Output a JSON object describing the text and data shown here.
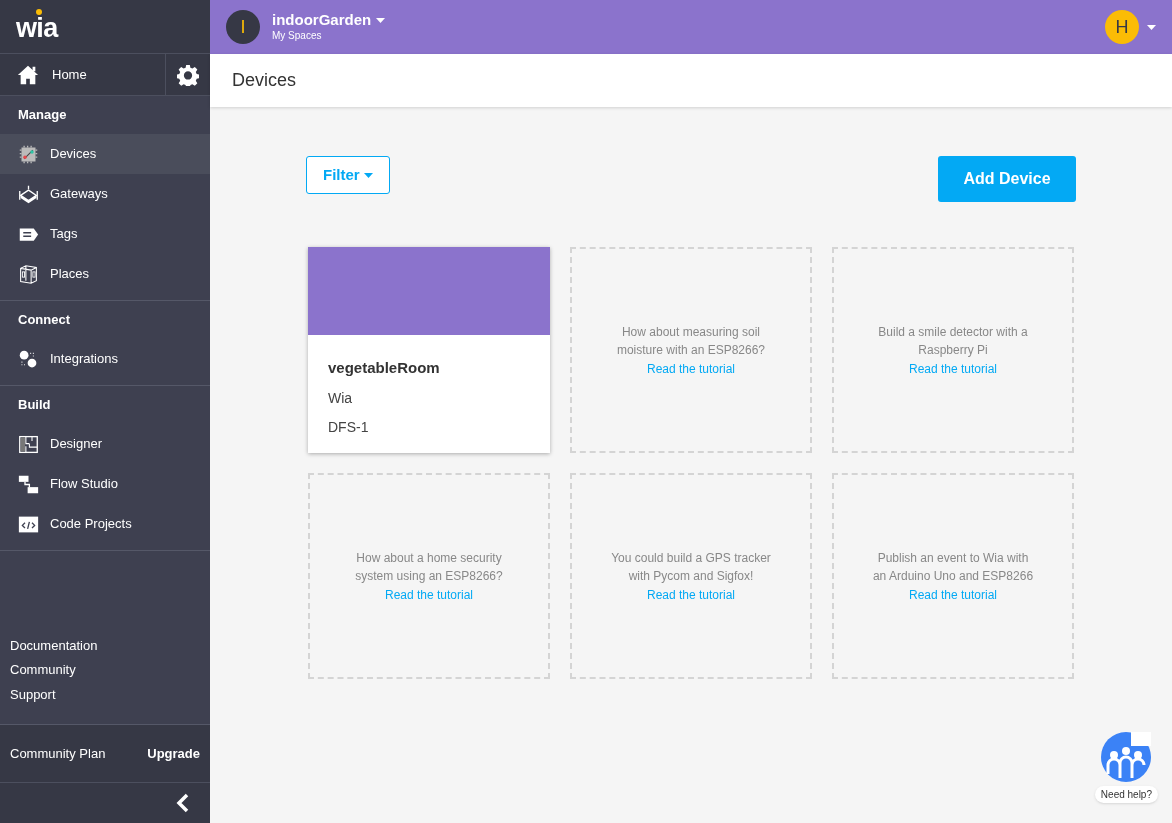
{
  "sidebar": {
    "logo": "wia",
    "home": {
      "label": "Home"
    },
    "sections": [
      {
        "heading": "Manage",
        "items": [
          {
            "label": "Devices",
            "kind": "chip",
            "selected": true
          },
          {
            "label": "Gateways",
            "kind": "gateway",
            "selected": false
          },
          {
            "label": "Tags",
            "kind": "tag",
            "selected": false
          },
          {
            "label": "Places",
            "kind": "place",
            "selected": false
          }
        ]
      },
      {
        "heading": "Connect",
        "items": [
          {
            "label": "Integrations",
            "kind": "integration",
            "selected": false
          }
        ]
      },
      {
        "heading": "Build",
        "items": [
          {
            "label": "Designer",
            "kind": "designer",
            "selected": false
          },
          {
            "label": "Flow Studio",
            "kind": "flow",
            "selected": false
          },
          {
            "label": "Code Projects",
            "kind": "code",
            "selected": false
          }
        ]
      }
    ],
    "links": [
      "Documentation",
      "Community",
      "Support"
    ],
    "plan": {
      "label": "Community Plan",
      "action": "Upgrade"
    }
  },
  "topbar": {
    "space_initial": "I",
    "space": "indoorGarden",
    "subtitle": "My Spaces",
    "user_initial": "H"
  },
  "page_title": "Devices",
  "filter": "Filter",
  "add_button": "Add Device",
  "cards": [
    {
      "kind": "device",
      "name": "vegetableRoom",
      "line_1": "Wia",
      "line_2": "DFS-1"
    },
    {
      "kind": "suggestion",
      "text": "How about measuring soil moisture with an ESP8266?",
      "link": "Read the tutorial"
    },
    {
      "kind": "suggestion",
      "text": "Build a smile detector with a Raspberry Pi",
      "link": "Read the tutorial"
    },
    {
      "kind": "suggestion",
      "text": "How about a home security system using an ESP8266?",
      "link": "Read the tutorial"
    },
    {
      "kind": "suggestion",
      "text": "You could build a GPS tracker with Pycom and Sigfox!",
      "link": "Read the tutorial"
    },
    {
      "kind": "suggestion",
      "text": "Publish an event to Wia with an Arduino Uno and ESP8266",
      "link": "Read the tutorial"
    }
  ],
  "help": "Need help?"
}
